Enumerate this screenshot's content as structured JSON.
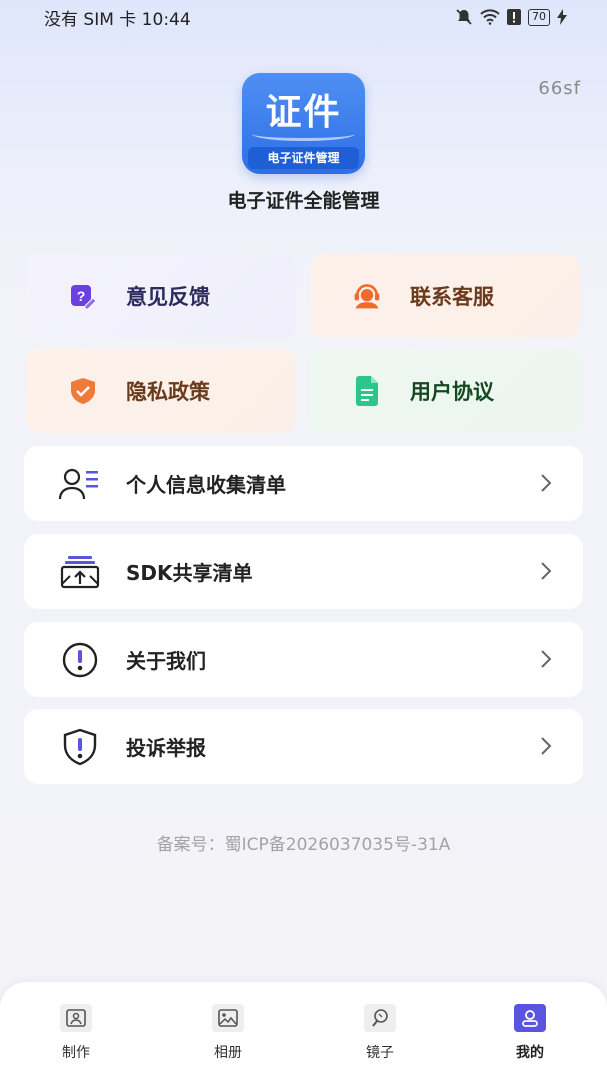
{
  "status_bar": {
    "carrier_time": "没有 SIM 卡 10:44",
    "battery": "70",
    "icons": [
      "mute-bell-icon",
      "wifi-icon",
      "alert-icon",
      "battery-icon",
      "charging-icon"
    ]
  },
  "version": "66sf",
  "logo": {
    "main": "证件",
    "sub": "电子证件管理"
  },
  "app_name": "电子证件全能管理",
  "tiles": [
    {
      "label": "意见反馈",
      "icon": "feedback-edit-icon",
      "color": "#6b3fe0"
    },
    {
      "label": "联系客服",
      "icon": "customer-service-icon",
      "color": "#f06a2a"
    },
    {
      "label": "隐私政策",
      "icon": "shield-check-icon",
      "color": "#f07a3a"
    },
    {
      "label": "用户协议",
      "icon": "document-icon",
      "color": "#2ec58a"
    }
  ],
  "rows": [
    {
      "label": "个人信息收集清单",
      "icon": "user-list-icon"
    },
    {
      "label": "SDK共享清单",
      "icon": "share-box-icon"
    },
    {
      "label": "关于我们",
      "icon": "info-circle-icon"
    },
    {
      "label": "投诉举报",
      "icon": "report-shield-icon"
    }
  ],
  "icp": "备案号：蜀ICP备2026037035号-31A",
  "tabs": [
    {
      "label": "制作",
      "icon": "portrait-frame-icon",
      "active": false
    },
    {
      "label": "相册",
      "icon": "gallery-icon",
      "active": false
    },
    {
      "label": "镜子",
      "icon": "mirror-icon",
      "active": false
    },
    {
      "label": "我的",
      "icon": "profile-icon",
      "active": true
    }
  ],
  "colors": {
    "accent": "#5a54e0",
    "logo_blue": "#2e6fe6"
  }
}
